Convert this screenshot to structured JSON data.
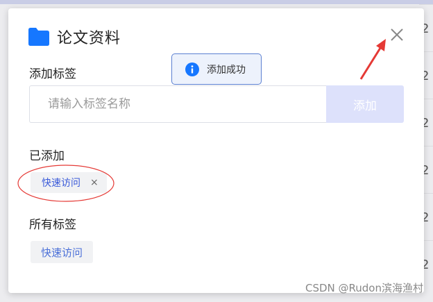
{
  "dialog": {
    "title": "论文资料",
    "add_tag_label": "添加标签",
    "input_placeholder": "请输入标签名称",
    "add_button_label": "添加",
    "added_label": "已添加",
    "added_tags": [
      {
        "label": "快速访问",
        "remove": "×"
      }
    ],
    "all_tags_label": "所有标签",
    "all_tags": [
      {
        "label": "快速访问"
      }
    ]
  },
  "toast": {
    "message": "添加成功"
  },
  "background": {
    "row_digits": [
      "2",
      "2",
      "2",
      "2",
      "2",
      "2",
      "2"
    ]
  },
  "watermark": "CSDN @Rudon滨海渔村",
  "icons": {
    "folder": "folder-icon",
    "close": "close-icon",
    "info": "info-icon",
    "arrow": "red-arrow-annotation",
    "ellipse": "red-ellipse-annotation"
  },
  "colors": {
    "accent_blue": "#1677ff",
    "add_button_bg": "#dde1fb",
    "annotation_red": "#e53935",
    "chip_text": "#3a5ad9"
  }
}
